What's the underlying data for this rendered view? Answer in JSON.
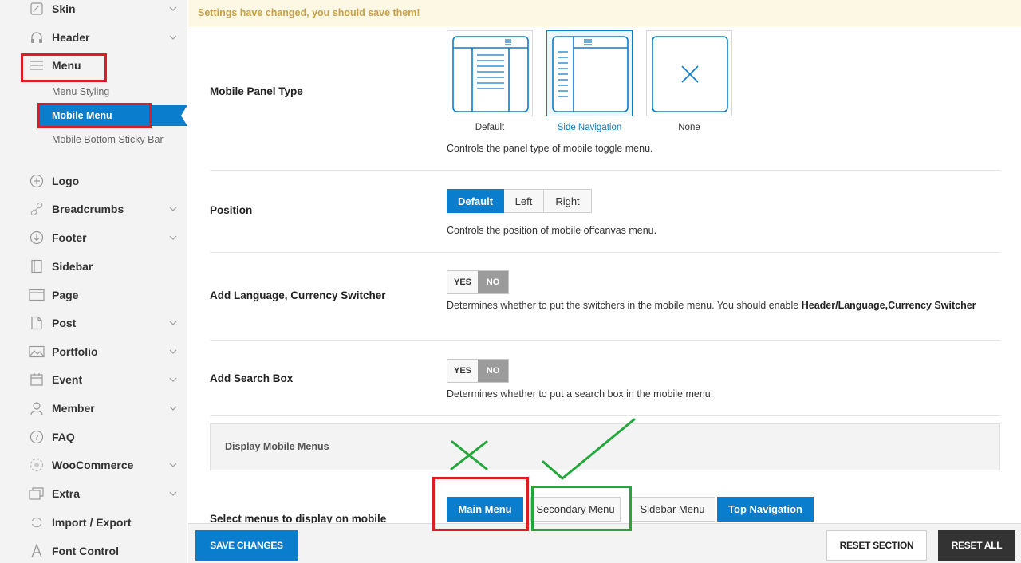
{
  "sidebar": {
    "items": [
      {
        "label": "Skin",
        "icon": "brush-icon",
        "chevron": true
      },
      {
        "label": "Header",
        "icon": "headphones-icon",
        "chevron": true
      },
      {
        "label": "Menu",
        "icon": "hamburger-menu-icon",
        "chevron": false
      },
      {
        "label": "Logo",
        "icon": "plus-circle-icon",
        "chevron": false
      },
      {
        "label": "Breadcrumbs",
        "icon": "link-icon",
        "chevron": true
      },
      {
        "label": "Footer",
        "icon": "arrow-down-circle-icon",
        "chevron": true
      },
      {
        "label": "Sidebar",
        "icon": "sidebar-icon",
        "chevron": false
      },
      {
        "label": "Page",
        "icon": "page-icon",
        "chevron": false
      },
      {
        "label": "Post",
        "icon": "post-icon",
        "chevron": true
      },
      {
        "label": "Portfolio",
        "icon": "image-icon",
        "chevron": true
      },
      {
        "label": "Event",
        "icon": "calendar-icon",
        "chevron": true
      },
      {
        "label": "Member",
        "icon": "user-icon",
        "chevron": true
      },
      {
        "label": "FAQ",
        "icon": "question-circle-icon",
        "chevron": false
      },
      {
        "label": "WooCommerce",
        "icon": "woocommerce-icon",
        "chevron": true
      },
      {
        "label": "Extra",
        "icon": "layers-icon",
        "chevron": true
      },
      {
        "label": "Import / Export",
        "icon": "sync-icon",
        "chevron": false
      },
      {
        "label": "Font Control",
        "icon": "font-icon",
        "chevron": false
      }
    ],
    "menu_subitems": [
      {
        "label": "Menu Styling",
        "active": false
      },
      {
        "label": "Mobile Menu",
        "active": true
      },
      {
        "label": "Mobile Bottom Sticky Bar",
        "active": false
      }
    ]
  },
  "notice": "Settings have changed, you should save them!",
  "mobile_panel_type": {
    "label": "Mobile Panel Type",
    "options": [
      "Default",
      "Side Navigation",
      "None"
    ],
    "selected": "Side Navigation",
    "description": "Controls the panel type of mobile toggle menu."
  },
  "position": {
    "label": "Position",
    "options": [
      "Default",
      "Left",
      "Right"
    ],
    "selected": "Default",
    "description": "Controls the position of mobile offcanvas menu."
  },
  "language_switcher": {
    "label": "Add Language, Currency Switcher",
    "yes": "YES",
    "no": "NO",
    "value": "NO",
    "description": "Determines whether to put the switchers in the mobile menu. You should enable ",
    "description_bold": "Header/Language,Currency Switcher"
  },
  "search_box": {
    "label": "Add Search Box",
    "yes": "YES",
    "no": "NO",
    "value": "NO",
    "description": "Determines whether to put a search box in the mobile menu."
  },
  "display_mobile_menus": {
    "title": "Display Mobile Menus"
  },
  "select_menus": {
    "label": "Select menus to display on mobile",
    "options": [
      "Main Menu",
      "Secondary Menu",
      "Sidebar Menu",
      "Top Navigation"
    ],
    "selected": [
      "Main Menu",
      "Top Navigation"
    ]
  },
  "footer": {
    "save": "SAVE CHANGES",
    "reset_section": "RESET SECTION",
    "reset_all": "RESET ALL"
  },
  "colors": {
    "accent": "#0a7dcd",
    "annotation_red": "#e01b24",
    "annotation_green": "#22a83a",
    "notice_text": "#c9a04a"
  }
}
